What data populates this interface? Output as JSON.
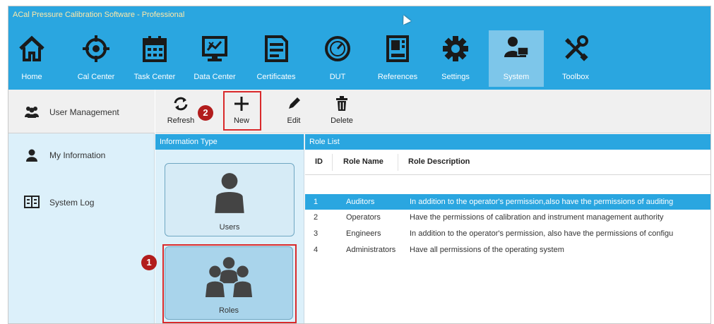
{
  "app": {
    "title": "ACal Pressure Calibration Software - Professional"
  },
  "ribbon": {
    "items": [
      {
        "label": "Home",
        "icon": "home-icon"
      },
      {
        "label": "Cal Center",
        "icon": "target-icon"
      },
      {
        "label": "Task Center",
        "icon": "calendar-icon"
      },
      {
        "label": "Data Center",
        "icon": "chart-monitor-icon"
      },
      {
        "label": "Certificates",
        "icon": "certificate-icon"
      },
      {
        "label": "DUT",
        "icon": "gauge-icon"
      },
      {
        "label": "References",
        "icon": "instrument-icon"
      },
      {
        "label": "Settings",
        "icon": "gear-icon"
      },
      {
        "label": "System",
        "icon": "user-computer-icon"
      },
      {
        "label": "Toolbox",
        "icon": "wrench-screwdriver-icon"
      }
    ],
    "active": "System"
  },
  "leftnav": {
    "items": [
      {
        "label": "User Management",
        "icon": "users-icon"
      },
      {
        "label": "My Information",
        "icon": "person-icon"
      },
      {
        "label": "System Log",
        "icon": "log-icon"
      }
    ]
  },
  "toolbar": {
    "refresh": "Refresh",
    "new": "New",
    "edit": "Edit",
    "delete": "Delete"
  },
  "info_panel": {
    "header": "Information Type",
    "users_label": "Users",
    "roles_label": "Roles"
  },
  "annotations": {
    "badge1": "1",
    "badge2": "2"
  },
  "role_list": {
    "header": "Role List",
    "columns": [
      "ID",
      "Role Name",
      "Role Description"
    ],
    "rows": [
      {
        "id": "1",
        "name": "Auditors",
        "desc": "In addition to the operator's permission,also have the permissions of auditing"
      },
      {
        "id": "2",
        "name": "Operators",
        "desc": "Have the permissions of calibration and instrument management authority"
      },
      {
        "id": "3",
        "name": "Engineers",
        "desc": "In addition to the operator's permission, also have the permissions of configu"
      },
      {
        "id": "4",
        "name": "Administrators",
        "desc": "Have all permissions of the operating system"
      }
    ],
    "selected_row": "1"
  },
  "colors": {
    "accent": "#2aa6e0",
    "highlight": "#d9292b",
    "badge": "#b21c1c"
  }
}
